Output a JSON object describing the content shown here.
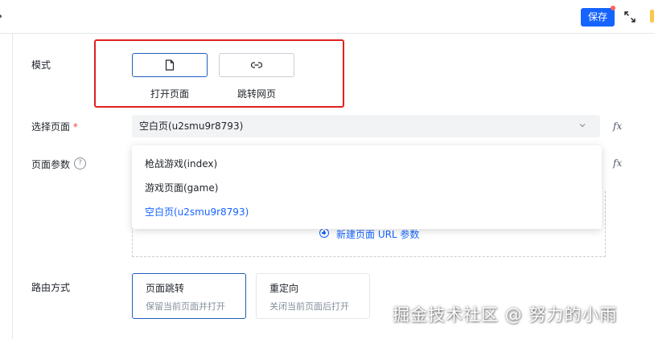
{
  "toolbar": {
    "save_label": "保存"
  },
  "form": {
    "mode_label": "模式",
    "mode_options": [
      {
        "label": "打开页面",
        "icon": "file-icon",
        "selected": true
      },
      {
        "label": "跳转网页",
        "icon": "link-icon",
        "selected": false
      }
    ],
    "select_page_label": "选择页面",
    "required_mark": "*",
    "selected_page": "空白页(u2smu9r8793)",
    "page_params_label": "页面参数",
    "help_glyph": "?",
    "add_param_label": "新建页面 URL 参数",
    "fx_label": "fx",
    "route_label": "路由方式",
    "route_options": [
      {
        "title": "页面跳转",
        "desc": "保留当前页面并打开",
        "selected": true
      },
      {
        "title": "重定向",
        "desc": "关闭当前页面后打开",
        "selected": false
      }
    ]
  },
  "dropdown": {
    "options": [
      {
        "label": "枪战游戏(index)",
        "selected": false
      },
      {
        "label": "游戏页面(game)",
        "selected": false
      },
      {
        "label": "空白页(u2smu9r8793)",
        "selected": true
      }
    ]
  },
  "watermark": "掘金技术社区 @ 努力的小雨",
  "colors": {
    "accent": "#1664ff",
    "highlight_border": "#e02020",
    "required": "#f53f3f"
  }
}
